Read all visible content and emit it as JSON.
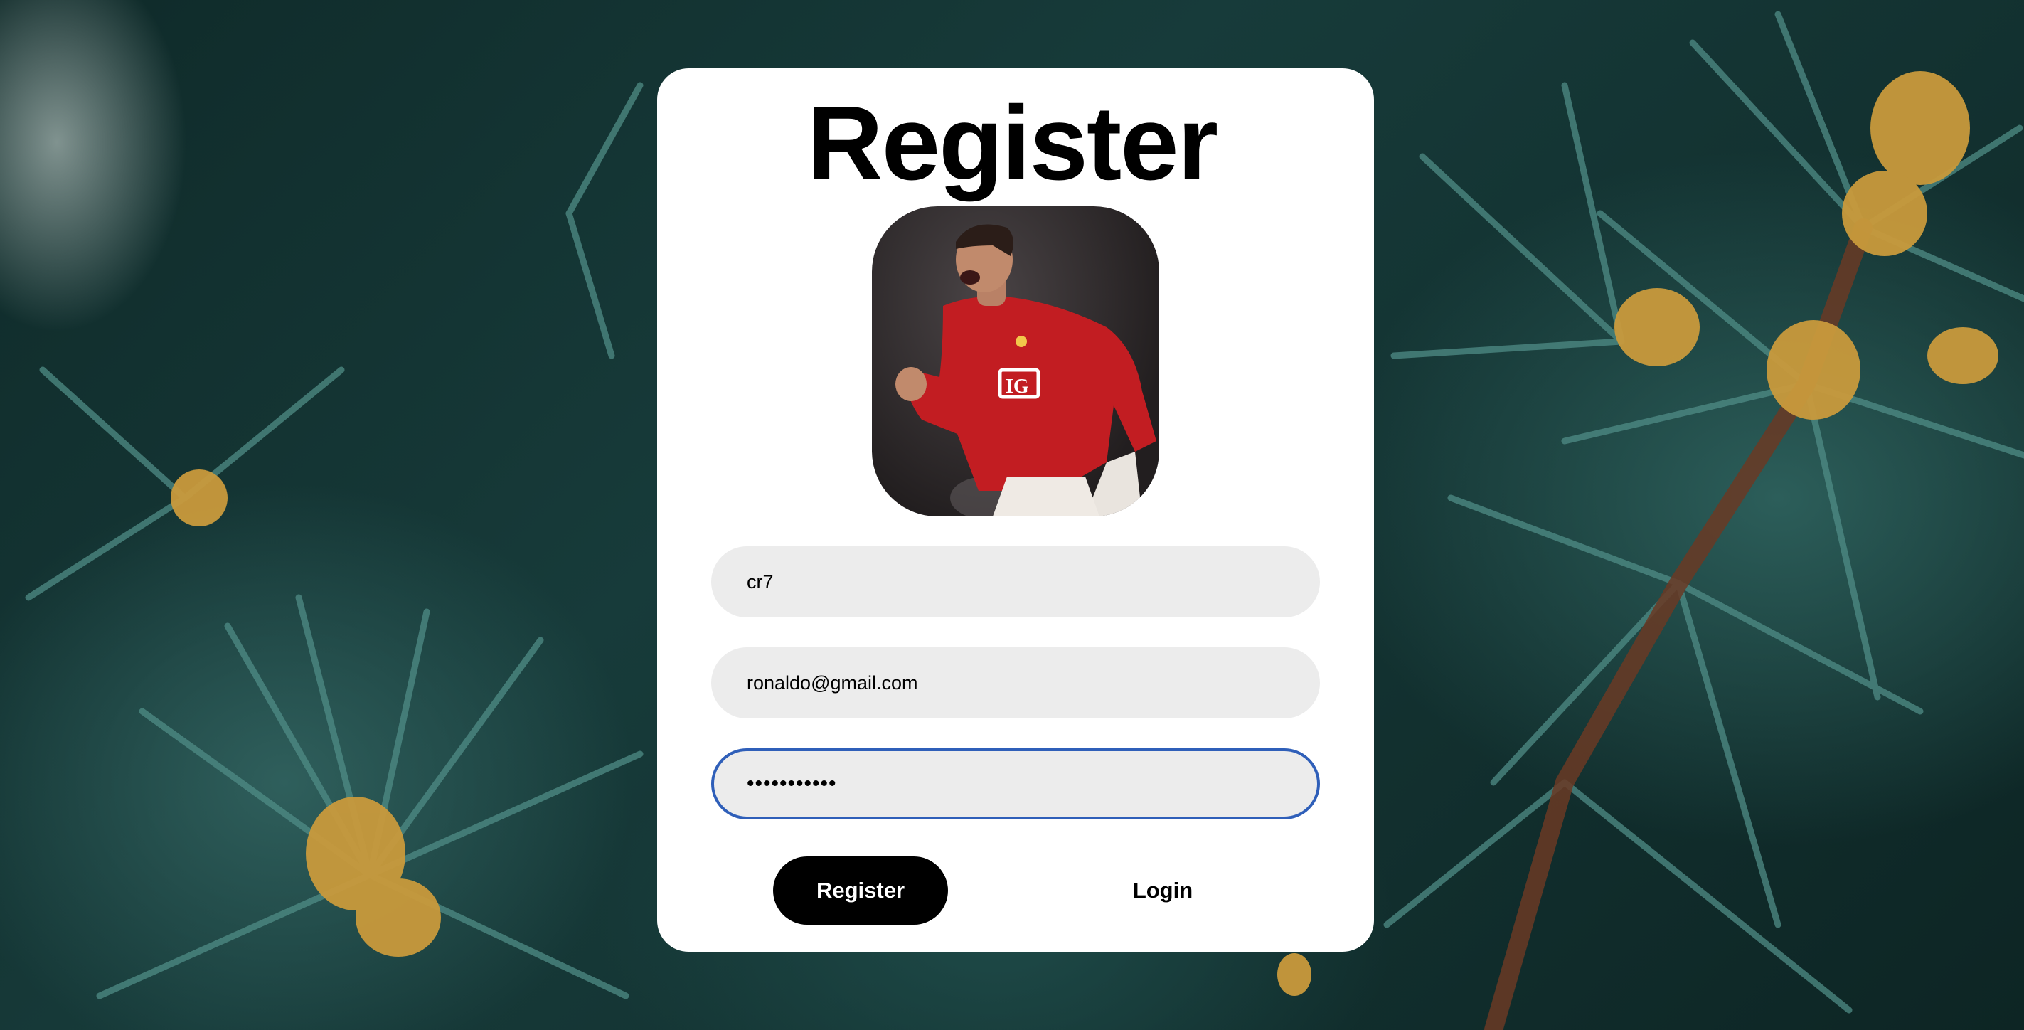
{
  "page": {
    "title": "Register"
  },
  "avatar": {
    "description_icon": "profile-photo"
  },
  "form": {
    "username_value": "cr7",
    "email_value": "ronaldo@gmail.com",
    "password_value": "•••••••••••"
  },
  "actions": {
    "register_label": "Register",
    "login_label": "Login"
  },
  "colors": {
    "card_background": "#ffffff",
    "field_background": "#ececec",
    "focus_border": "#2f5fb9",
    "primary_button": "#000000"
  }
}
